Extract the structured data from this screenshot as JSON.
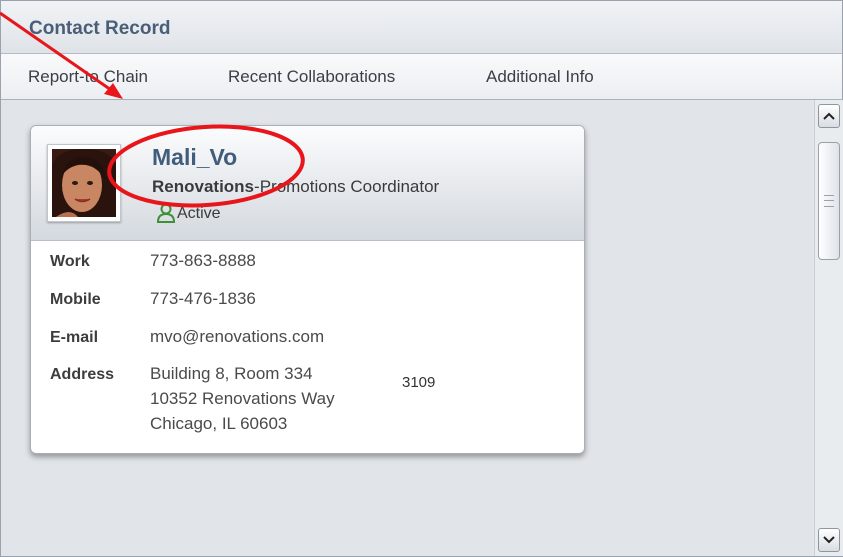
{
  "window": {
    "title": "Contact Record"
  },
  "tabs": [
    {
      "label": "Report-to Chain"
    },
    {
      "label": "Recent Collaborations"
    },
    {
      "label": "Additional Info"
    }
  ],
  "contact": {
    "name": "Mali_Vo",
    "company": "Renovations",
    "role": "-Promotions Coordinator",
    "status": "Active",
    "fields": [
      {
        "label": "Work",
        "value": "773-863-8888"
      },
      {
        "label": "Mobile",
        "value": "773-476-1836"
      },
      {
        "label": "E-mail",
        "value": "mvo@renovations.com"
      },
      {
        "label": "Address",
        "lines": [
          "Building 8, Room 334",
          "10352 Renovations Way",
          "Chicago, IL 60603"
        ]
      }
    ]
  },
  "overflow_text": "3109",
  "scrollbar": {
    "up_icon": "chevron-up-icon",
    "down_icon": "chevron-down-icon"
  },
  "colors": {
    "title": "#4a5e78",
    "name": "#425d7c",
    "status_icon": "#3f8f3a",
    "annotation": "#e8161b"
  }
}
